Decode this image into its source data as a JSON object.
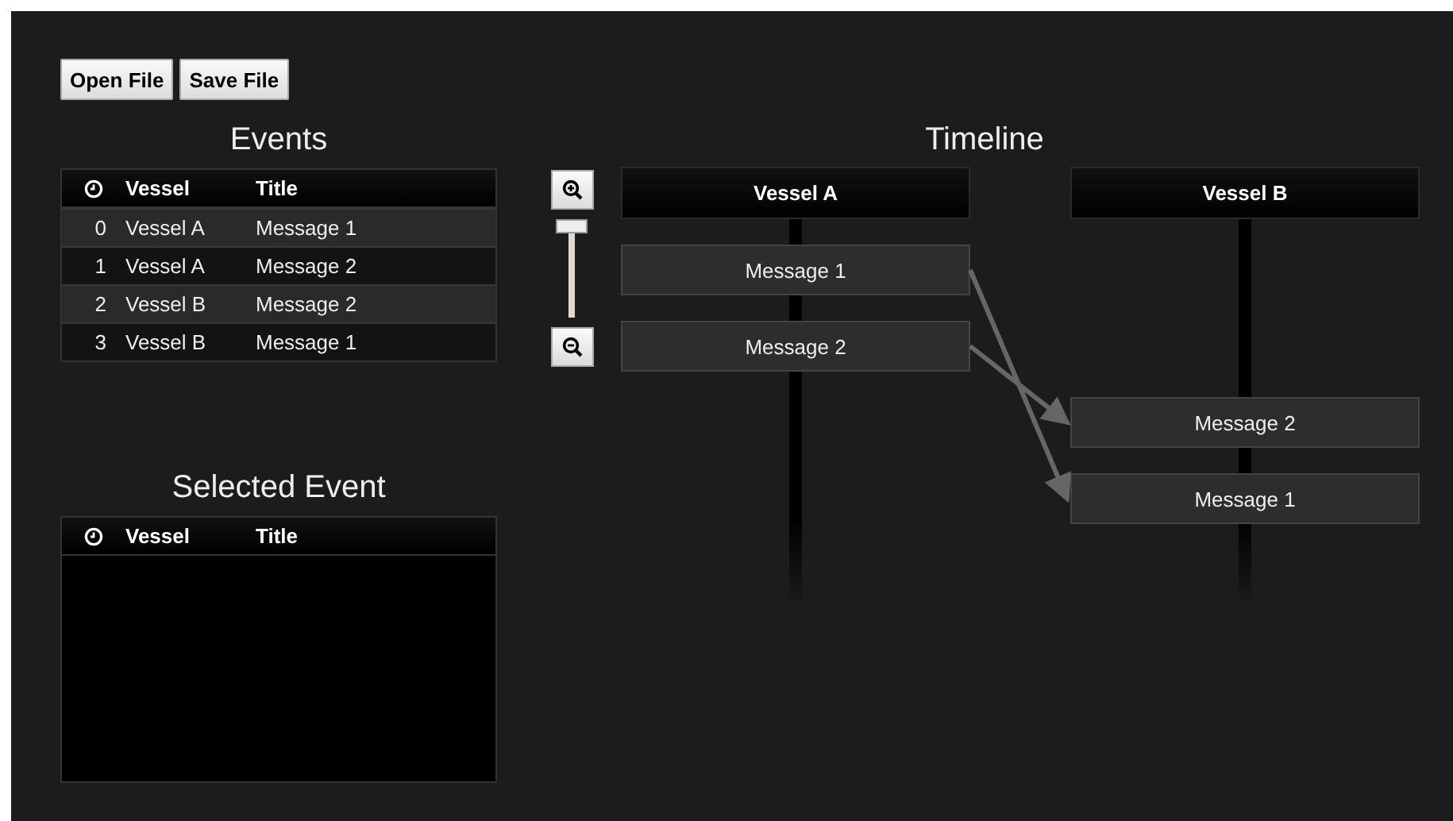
{
  "toolbar": {
    "buttons": [
      "Open File",
      "Save File"
    ]
  },
  "events": {
    "title": "Events",
    "columns": [
      "Vessel",
      "Title"
    ],
    "rows": [
      {
        "index": "0",
        "vessel": "Vessel A",
        "title": "Message 1"
      },
      {
        "index": "1",
        "vessel": "Vessel A",
        "title": "Message 2"
      },
      {
        "index": "2",
        "vessel": "Vessel B",
        "title": "Message 2"
      },
      {
        "index": "3",
        "vessel": "Vessel B",
        "title": "Message 1"
      }
    ]
  },
  "selected_event": {
    "title": "Selected Event",
    "columns": [
      "Vessel",
      "Title"
    ]
  },
  "timeline": {
    "title": "Timeline",
    "zoom": {
      "level": 1
    },
    "lanes": [
      {
        "name": "Vessel A"
      },
      {
        "name": "Vessel B"
      }
    ],
    "messages": [
      {
        "kind": "sent",
        "title": "Message 1"
      },
      {
        "kind": "sent",
        "title": "Message 2"
      },
      {
        "kind": "received",
        "title": "Message 2"
      },
      {
        "kind": "received",
        "title": "Message 1"
      }
    ]
  }
}
